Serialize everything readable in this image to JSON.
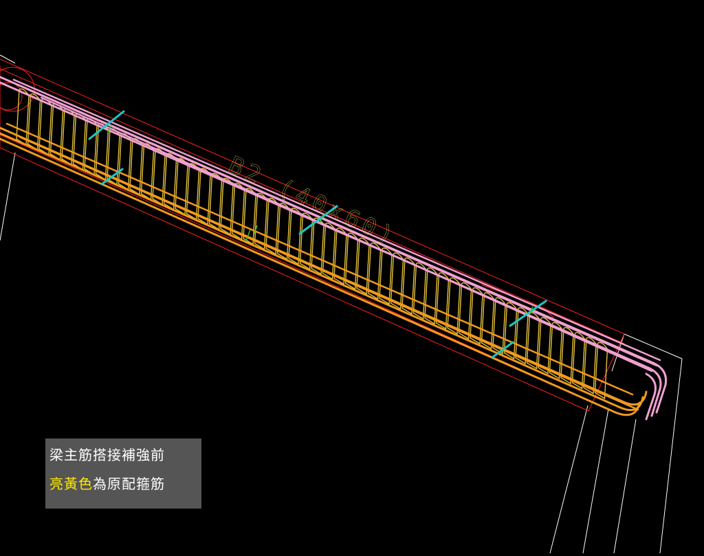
{
  "canvas": {
    "background": "#000000",
    "view": "3D wireframe rebar model (CAD)"
  },
  "beam_label": {
    "text": "B2 (40x60)",
    "color": "#d8d860"
  },
  "caption": {
    "line1": "梁主筋搭接補強前",
    "line2_highlight": "亮黃色",
    "line2_rest": "為原配箍筋",
    "highlight_color": "#ffea00",
    "text_color": "#ffffff",
    "background": "#555555"
  },
  "colors": {
    "stirrup_yellow": "#e6c23a",
    "bottom_bar_orange": "#f29a1c",
    "top_bar_pink": "#f0a0d0",
    "outline_red": "#ff2020",
    "splice_marker_cyan": "#19c9c9",
    "column_outline_white": "#ffffff"
  }
}
